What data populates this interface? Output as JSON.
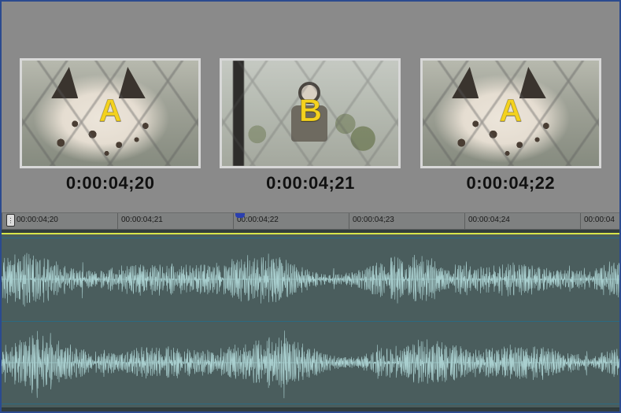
{
  "frames": [
    {
      "clip_label": "A",
      "timecode": "0:00:04;20"
    },
    {
      "clip_label": "B",
      "timecode": "0:00:04;21"
    },
    {
      "clip_label": "A",
      "timecode": "0:00:04;22"
    }
  ],
  "ruler": {
    "ticks": [
      "00:00:04;20",
      "00:00:04;21",
      "00:00:04;22",
      "00:00:04;23",
      "00:00:04;24",
      "00:00:04"
    ],
    "playhead_tick_index": 0,
    "cti_marker_tick_index": 2
  },
  "colors": {
    "clip_label": "#f4d21e",
    "waveform": "#a9cfcf",
    "clip_bg": "#4a5d5d",
    "clip_top_border": "#d7e44a"
  }
}
